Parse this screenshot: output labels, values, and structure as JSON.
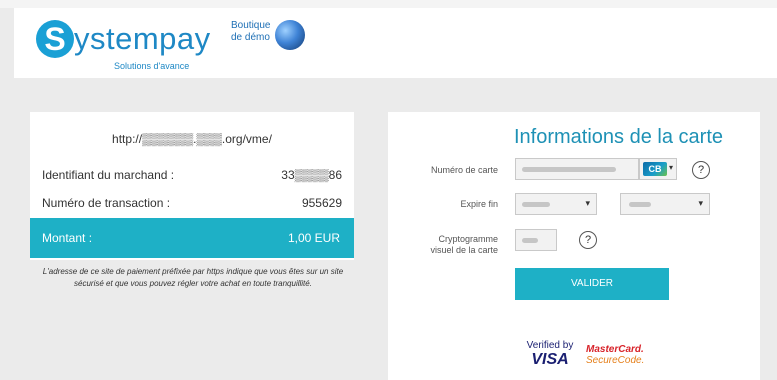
{
  "header": {
    "brand_letter": "S",
    "brand_word": "ystempay",
    "brand_tagline": "Solutions d'avance",
    "shop_line1": "Boutique",
    "shop_line2": "de démo",
    "globe_icon": "globe-icon"
  },
  "order": {
    "url": "http://▒▒▒▒▒▒.▒▒▒.org/vme/",
    "merchant_label": "Identifiant du marchand :",
    "merchant_value": "33▒▒▒▒86",
    "transaction_label": "Numéro de transaction :",
    "transaction_value": "955629",
    "amount_label": "Montant :",
    "amount_value": "1,00 EUR",
    "security_note": "L'adresse de ce site de paiement préfixée par https indique que vous êtes sur un site sécurisé et que vous pouvez régler votre achat en toute tranquillité."
  },
  "card": {
    "title": "Informations de la carte",
    "number_label": "Numéro de carte",
    "expiry_label": "Expire fin",
    "cvv_label_1": "Cryptogramme",
    "cvv_label_2": "visuel de la carte",
    "card_brand_badge": "CB",
    "help_symbol": "?",
    "submit_label": "VALIDER"
  },
  "badges": {
    "visa_line1": "Verified by",
    "visa_line2": "VISA",
    "mc_line1": "MasterCard.",
    "mc_line2": "SecureCode."
  },
  "colors": {
    "accent": "#1eb0c6",
    "title_blue": "#1e91b5",
    "brand_blue": "#1e88c5"
  }
}
